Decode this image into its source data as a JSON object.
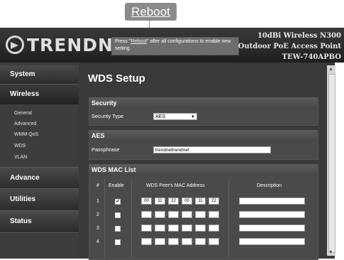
{
  "callout": {
    "label": "Reboot"
  },
  "header": {
    "logo": "TRENDNET",
    "note_pre": "Press \"",
    "note_link": "Reboot",
    "note_post": "\" after all configurations to enable new setting.",
    "product_line1": "10dBi Wireless N300",
    "product_line2": "Outdoor PoE Access Point",
    "product_line3": "TEW-740APBO"
  },
  "sidebar": {
    "system": "System",
    "wireless": "Wireless",
    "wireless_items": [
      "General",
      "Advanced",
      "WMM QoS",
      "WDS",
      "VLAN"
    ],
    "advance": "Advance",
    "utilities": "Utilities",
    "status": "Status"
  },
  "page": {
    "title": "WDS Setup"
  },
  "security": {
    "heading": "Security",
    "type_label": "Security Type",
    "type_value": "AES"
  },
  "aes": {
    "heading": "AES",
    "passphrase_label": "Passphrase",
    "passphrase_value": "trendnettrendnet"
  },
  "mac_list": {
    "heading": "WDS MAC List",
    "col_num": "#",
    "col_enable": "Enable",
    "col_mac": "WDS Peer's MAC Address",
    "col_desc": "Description",
    "rows": [
      {
        "num": "1",
        "checked": "✔",
        "mac": [
          "00",
          "11",
          "22",
          "00",
          "11",
          "22"
        ]
      },
      {
        "num": "2",
        "checked": "",
        "mac": [
          "",
          "",
          "",
          "",
          "",
          ""
        ]
      },
      {
        "num": "3",
        "checked": "",
        "mac": [
          "",
          "",
          "",
          "",
          "",
          ""
        ]
      },
      {
        "num": "4",
        "checked": "",
        "mac": [
          "",
          "",
          "",
          "",
          "",
          ""
        ]
      }
    ]
  },
  "colors": {
    "accent": "#8b8b8b",
    "panel": "#4a4a4a",
    "background": "#3a3a3a"
  }
}
